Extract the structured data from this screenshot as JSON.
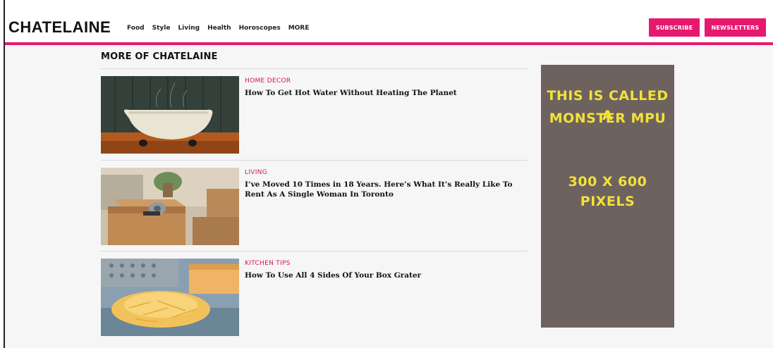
{
  "header": {
    "logo": "CHATELAINE",
    "nav": [
      "Food",
      "Style",
      "Living",
      "Health",
      "Horoscopes",
      "MORE"
    ],
    "subscribe_label": "SUBSCRIBE",
    "newsletters_label": "NEWSLETTERS"
  },
  "section": {
    "title": "MORE OF CHATELAINE"
  },
  "articles": [
    {
      "category": "HOME DECOR",
      "headline": "How To Get Hot Water Without Heating The Planet",
      "image_icon": "bathtub-image"
    },
    {
      "category": "LIVING",
      "headline": "I’ve Moved 10 Times in 18 Years. Here’s What It’s Really Like To Rent As A Single Woman In Toronto",
      "image_icon": "moving-boxes-image"
    },
    {
      "category": "KITCHEN TIPS",
      "headline": "How To Use All 4 Sides Of Your Box Grater",
      "image_icon": "grated-cheese-image"
    }
  ],
  "ad": {
    "line1": "THIS IS CALLED A",
    "line2": "MONSTER MPU",
    "line3": "300 X 600 PIXELS",
    "background": "#6e625e",
    "text_color": "#f2e13a"
  },
  "colors": {
    "accent": "#e6196e",
    "category": "#d4145a"
  }
}
